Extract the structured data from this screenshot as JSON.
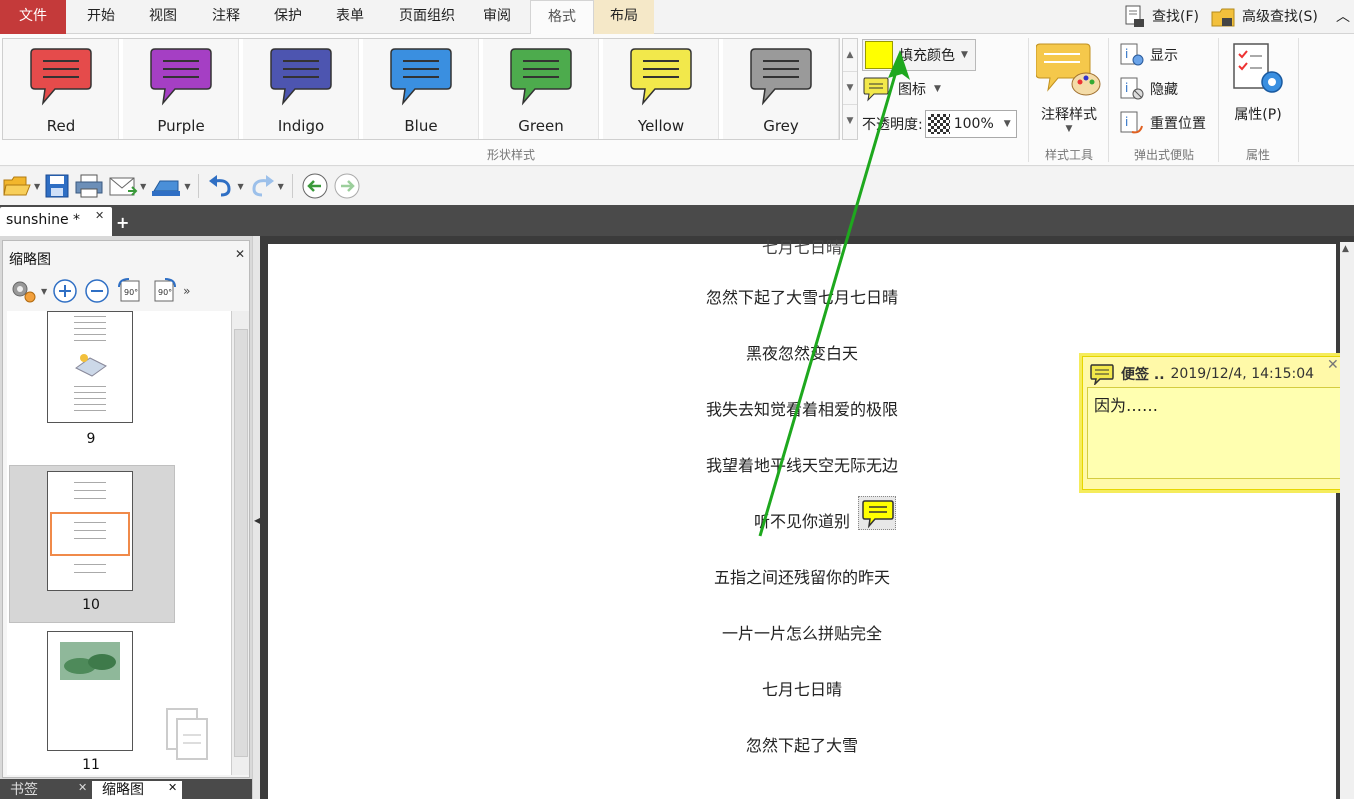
{
  "menu": {
    "file": "文件",
    "items": [
      "开始",
      "视图",
      "注释",
      "保护",
      "表单",
      "页面组织",
      "审阅"
    ],
    "format_tab": "格式",
    "layout_tab": "布局",
    "find": "查找(F)",
    "advanced_find": "高级查找(S)"
  },
  "ribbon": {
    "styles": [
      {
        "label": "Red",
        "color": "#e54b4b"
      },
      {
        "label": "Purple",
        "color": "#a53fc4"
      },
      {
        "label": "Indigo",
        "color": "#4d55b0"
      },
      {
        "label": "Blue",
        "color": "#3a8fe0"
      },
      {
        "label": "Green",
        "color": "#4dab4d"
      },
      {
        "label": "Yellow",
        "color": "#f2e84b"
      },
      {
        "label": "Grey",
        "color": "#9a9a9a"
      }
    ],
    "shape_style_group": "形状样式",
    "fill_color": "填充颜色",
    "fill_swatch_color": "#ffff00",
    "icon": "图标",
    "opacity_label": "不透明度:",
    "opacity_value": "100%",
    "annotation_style": "注释样式",
    "style_tools_group": "样式工具",
    "show": "显示",
    "hide": "隐藏",
    "reset_position": "重置位置",
    "popup_note_group": "弹出式便贴",
    "properties": "属性(P)",
    "properties_group": "属性"
  },
  "tabs": {
    "document": "sunshine *",
    "new_tab": "+"
  },
  "panel": {
    "title": "缩略图",
    "rotate_left": "90°",
    "rotate_right": "90°",
    "pages": [
      {
        "num": "9"
      },
      {
        "num": "10"
      },
      {
        "num": "11"
      }
    ],
    "bottom_tabs": [
      "书签",
      "缩略图"
    ]
  },
  "document": {
    "partial_top": "七月七日晴",
    "lines": [
      "忽然下起了大雪七月七日晴",
      "黑夜忽然变白天",
      "我失去知觉看着相爱的极限",
      "我望着地平线天空无际无边",
      "听不见你道别",
      "五指之间还残留你的昨天",
      "一片一片怎么拼贴完全",
      "七月七日晴",
      "忽然下起了大雪"
    ]
  },
  "note": {
    "author": "便签 ..",
    "timestamp": "2019/12/4, 14:15:04",
    "body": "因为……"
  }
}
